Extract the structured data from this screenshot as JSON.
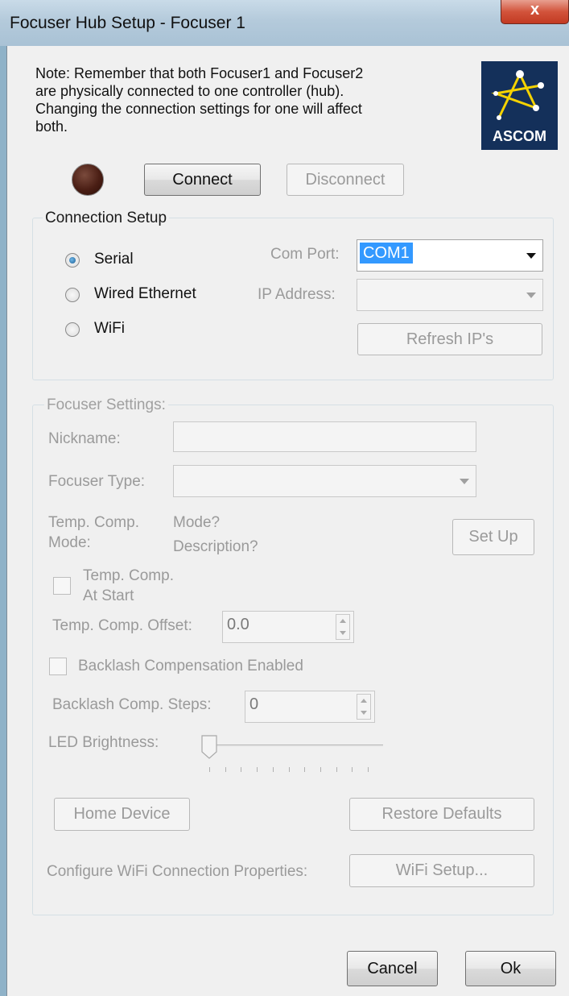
{
  "window": {
    "title": "Focuser Hub Setup - Focuser 1",
    "close_glyph": "x"
  },
  "note": "Note: Remember that both Focuser1 and Focuser2 are physically connected to one controller (hub). Changing the connection settings for one will affect both.",
  "logo": {
    "text": "ASCOM",
    "background": "#14305a"
  },
  "connection_led": {
    "state": "off",
    "color": "#4a1e14"
  },
  "buttons": {
    "connect": "Connect",
    "disconnect": "Disconnect",
    "refresh_ips": "Refresh IP's",
    "set_up": "Set Up",
    "home_device": "Home Device",
    "restore_defaults": "Restore Defaults",
    "wifi_setup": "WiFi Setup...",
    "cancel": "Cancel",
    "ok": "Ok"
  },
  "connection_setup": {
    "title": "Connection Setup",
    "options": [
      {
        "label": "Serial",
        "checked": true
      },
      {
        "label": "Wired Ethernet",
        "checked": false
      },
      {
        "label": "WiFi",
        "checked": false
      }
    ],
    "com_port_label": "Com Port:",
    "com_port_value": "COM1",
    "ip_address_label": "IP Address:",
    "ip_address_value": ""
  },
  "focuser_settings": {
    "title": "Focuser Settings:",
    "nickname_label": "Nickname:",
    "nickname_value": "",
    "focuser_type_label": "Focuser Type:",
    "focuser_type_value": "",
    "temp_comp_mode_label_1": "Temp. Comp.",
    "temp_comp_mode_label_2": "Mode:",
    "mode_value": "Mode?",
    "description_value": "Description?",
    "temp_comp_at_start_1": "Temp. Comp.",
    "temp_comp_at_start_2": "At Start",
    "temp_comp_at_start_checked": false,
    "temp_comp_offset_label": "Temp. Comp. Offset:",
    "temp_comp_offset_value": "0.0",
    "backlash_enabled_label": "Backlash Compensation Enabled",
    "backlash_enabled_checked": false,
    "backlash_steps_label": "Backlash Comp. Steps:",
    "backlash_steps_value": "0",
    "led_brightness_label": "LED Brightness:",
    "led_brightness_level": 0,
    "configure_wifi_label": "Configure WiFi Connection Properties:"
  }
}
